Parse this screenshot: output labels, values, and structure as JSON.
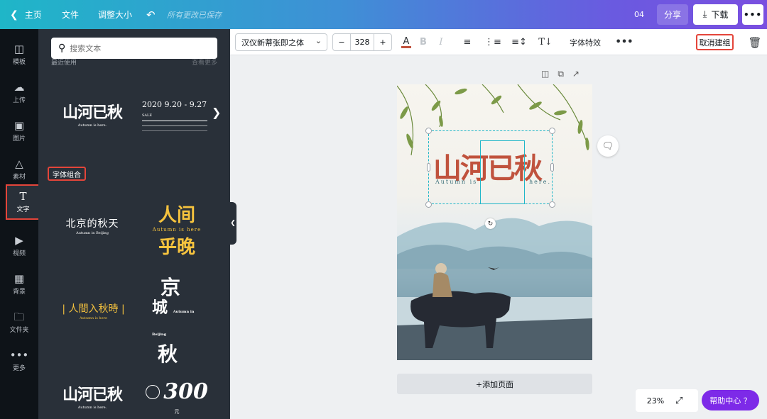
{
  "topbar": {
    "home_label": "主页",
    "file_label": "文件",
    "resize_label": "调整大小",
    "saved_status": "所有更改已保存",
    "page_count": "04",
    "share_label": "分享",
    "download_label": "下载",
    "more_glyph": "•••"
  },
  "rail": {
    "items": [
      {
        "label": "模板",
        "icon": "template-icon"
      },
      {
        "label": "上传",
        "icon": "upload-icon"
      },
      {
        "label": "图片",
        "icon": "image-icon"
      },
      {
        "label": "素材",
        "icon": "elements-icon"
      },
      {
        "label": "文字",
        "icon": "text-icon"
      },
      {
        "label": "视频",
        "icon": "video-icon"
      },
      {
        "label": "背景",
        "icon": "background-icon"
      },
      {
        "label": "文件夹",
        "icon": "folder-icon"
      },
      {
        "label": "更多",
        "icon": "more-icon"
      }
    ]
  },
  "panel": {
    "search_placeholder": "搜索文本",
    "recent_label": "最近使用",
    "see_all_label": "查看更多",
    "font_combo_label": "字体组合",
    "tiles": {
      "t1_title": "山河已秋",
      "t1_sub": "Autumn  is  here.",
      "t2_line1": "2020  9.20 - 9.27",
      "t2_line2": "SALE",
      "t3_title": "北京的秋天",
      "t3_sub": "Autumn in Beijing",
      "t4_line1": "人间",
      "t4_sub": "Autumn is here",
      "t4_line2": "乎晚",
      "t5_title": "| 人間入秋時 |",
      "t5_sub": "Autumn  is  here",
      "t6_a": "京",
      "t6_b": "城",
      "t6_c": "秋",
      "t6_sub": "Autumn in Beijing",
      "t7_title": "山河已秋",
      "t7_sub": "Autumn  is  here.",
      "t8_value": "300",
      "t8_unit": "元"
    }
  },
  "toolbar": {
    "font_name": "汉仪新蒂张即之体",
    "font_size": "328",
    "minus": "−",
    "plus": "+",
    "bold": "B",
    "italic": "I",
    "effects_label": "字体特效",
    "more_glyph": "•••",
    "ungroup_label": "取消建组"
  },
  "canvas": {
    "title": "山河已秋",
    "sub_left": "Autumn  is",
    "sub_right": "here."
  },
  "footer": {
    "add_page_label": "+添加页面",
    "zoom": "23%",
    "help_label": "帮助中心 ？"
  },
  "colors": {
    "accent_red": "#e4453a",
    "brand_purple": "#7d2ae8",
    "title_red": "#c0523d"
  }
}
